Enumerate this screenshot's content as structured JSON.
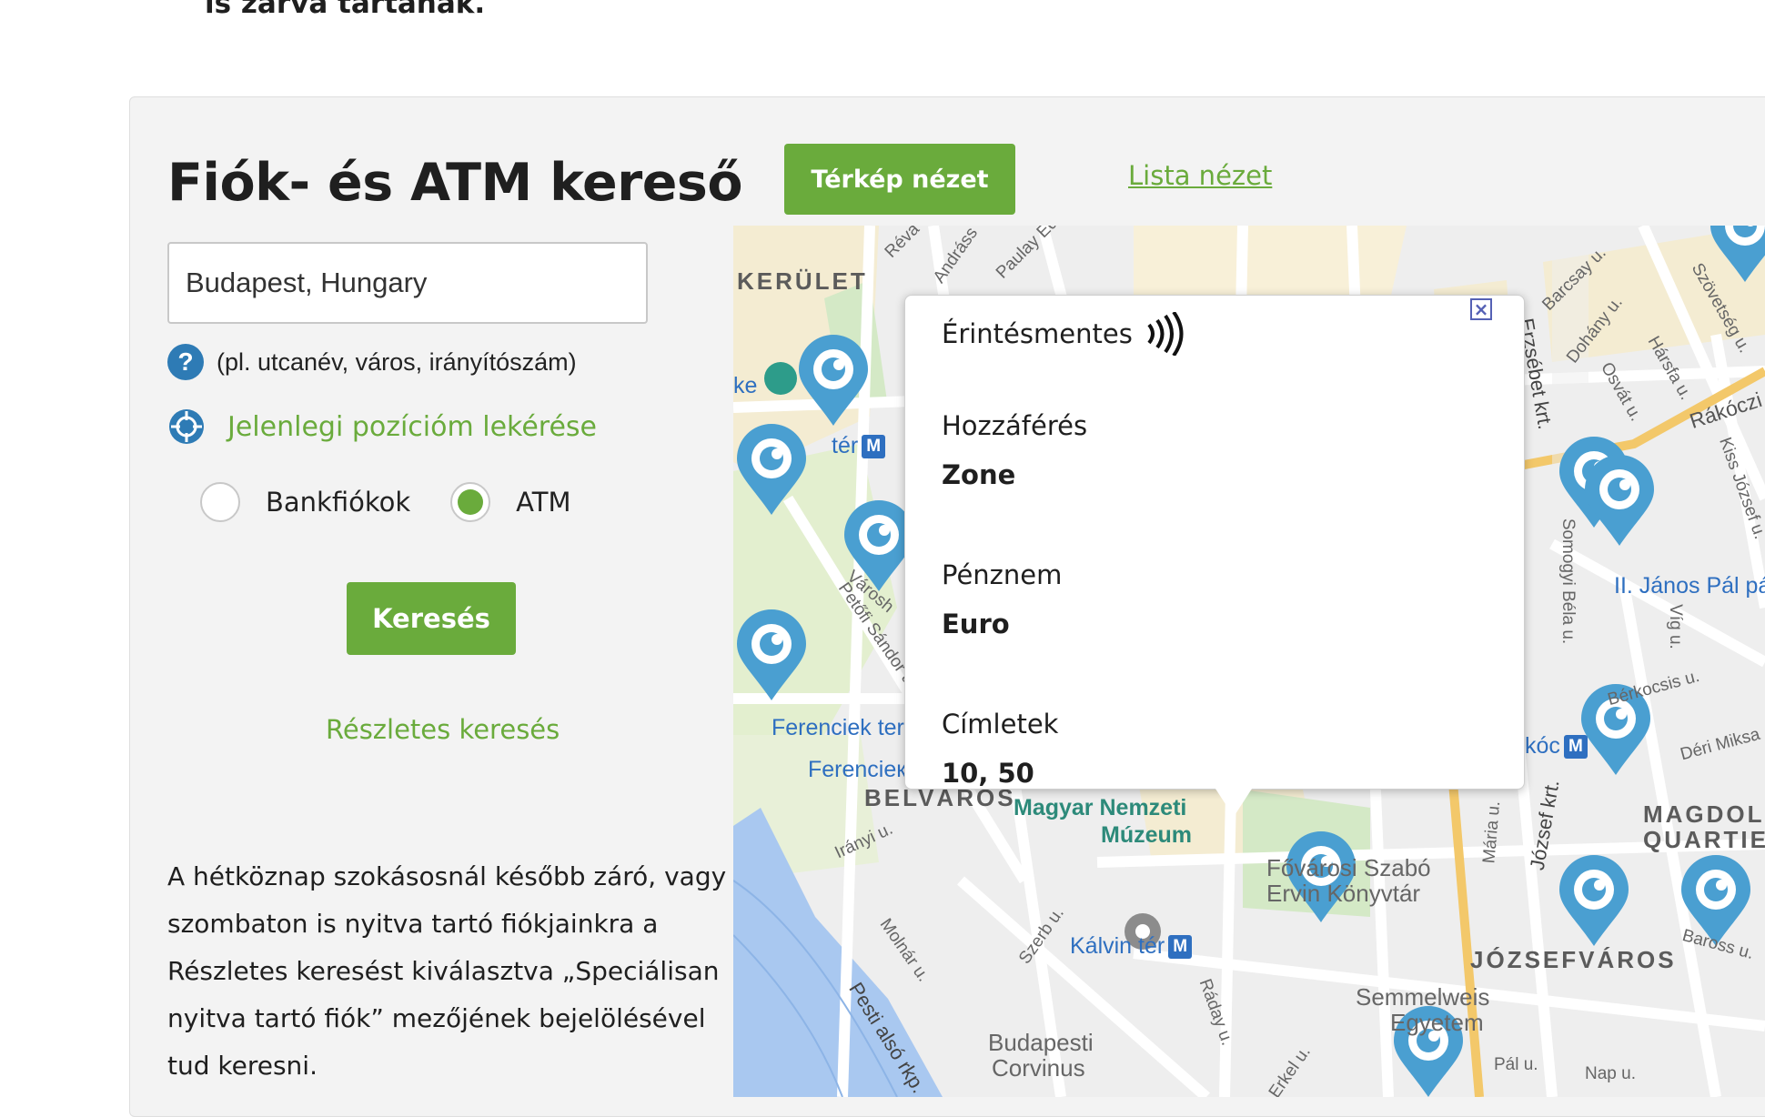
{
  "top_text": "is zárva tartanak.",
  "finder": {
    "title": "Fiók- és ATM kereső",
    "search_value": "Budapest, Hungary",
    "help_text": "(pl. utcanév, város, irányítószám)",
    "locate_text": "Jelenlegi pozícióm lekérése",
    "radio_branch": "Bankfiókok",
    "radio_atm": "ATM",
    "selected": "ATM",
    "search_button": "Keresés",
    "advanced_link": "Részletes keresés",
    "info_text": "A hétköznap szokásosnál később záró, vagy szombaton is nyitva tartó fiókjainkra a Részletes keresést kiválasztva „Speciálisan nyitva tartó fiók” mezőjének bejelölésével tud keresni."
  },
  "view_toggle": {
    "map_view": "Térkép nézet",
    "list_view": "Lista nézet"
  },
  "popup": {
    "title": "Érintésmentes",
    "access_label": "Hozzáférés",
    "access_value": "Zone",
    "currency_label": "Pénznem",
    "currency_value": "Euro",
    "denom_label": "Címletek",
    "denom_value": "10, 50"
  },
  "map_labels": {
    "kerulet": "KERÜLET",
    "ke": "ke",
    "ter": "tér",
    "belvaros": "BELVÁROS",
    "jozsefvaros": "JÓZSEFVÁROS",
    "magdolna_1": "MAGDOLNA",
    "magdolna_2": "QUARTIER",
    "ferenciek_1": "Ferenciek ter",
    "ferenciek_2": "Ferencieк",
    "museum_1": "Magyar Nemzeti",
    "museum_2": "Múzeum",
    "library_1": "Fővárosi Szabó",
    "library_2": "Ervin Könyvtár",
    "kalvin": "Kálvin tér",
    "semmelweis_1": "Semmelweis",
    "semmelweis_2": "Egyetem",
    "corvinus_1": "Budapesti",
    "corvinus_2": "Corvinus",
    "janos_pal": "II. János Pál pá",
    "rakoczi": "Rákóczi",
    "koci": "kóc",
    "st_andrassy": "Andráss",
    "st_paulay": "Paulay Ed",
    "st_reva": "Réva",
    "st_barcsay": "Barcsay u.",
    "st_dohany": "Dohány u.",
    "st_szovetseg": "Szövetség u.",
    "st_harsfa": "Hársfa u.",
    "st_osvat": "Osvát u.",
    "st_kiss": "Kiss József u.",
    "st_erzsebet": "Erzsébet krt.",
    "st_somogyi": "Somogyi Béla u.",
    "st_vig": "Víg u.",
    "st_berkocsis": "Bérkocsis u.",
    "st_deri": "Déri Miksa",
    "st_maria": "Mária u.",
    "st_jozsef": "József krt.",
    "st_baross": "Baross u.",
    "st_pal": "Pál u.",
    "st_nap": "Nap u.",
    "st_irany": "Irányi u.",
    "st_molnar": "Molnár u.",
    "st_pesti": "Pesti alsó rkp.",
    "st_szerb": "Szerb u.",
    "st_raday": "Ráday u.",
    "st_erkel": "Erkel u.",
    "st_petofi": "Petőfi Sándor u.",
    "st_varosh": "Városh",
    "metro_letter": "M"
  },
  "colors": {
    "brand_green": "#6aab3c",
    "marker_blue": "#4a9fd1",
    "help_blue": "#2e7bb5"
  }
}
